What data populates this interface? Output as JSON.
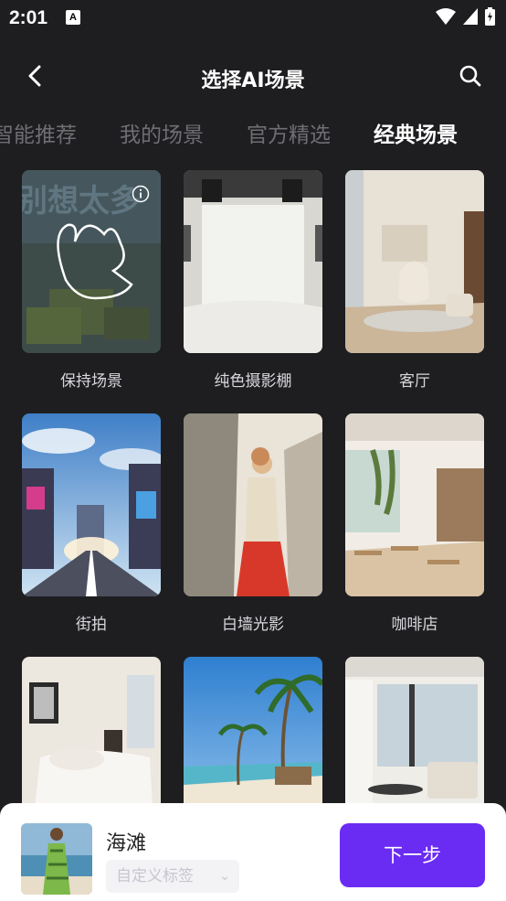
{
  "status": {
    "time": "2:01",
    "app_icon_letter": "A"
  },
  "nav": {
    "title": "选择AI场景"
  },
  "tabs": [
    "智能推荐",
    "我的场景",
    "官方精选",
    "经典场景"
  ],
  "scenes": [
    {
      "label": "保持场景"
    },
    {
      "label": "纯色摄影棚"
    },
    {
      "label": "客厅"
    },
    {
      "label": "街拍"
    },
    {
      "label": "白墙光影"
    },
    {
      "label": "咖啡店"
    },
    {
      "label": ""
    },
    {
      "label": ""
    },
    {
      "label": ""
    }
  ],
  "bottom": {
    "scene_name": "海滩",
    "tag_placeholder": "自定义标签",
    "next_label": "下一步"
  },
  "colors": {
    "accent": "#6a2cf2",
    "background": "#1e1e21",
    "tab_inactive": "#6e6e73"
  }
}
